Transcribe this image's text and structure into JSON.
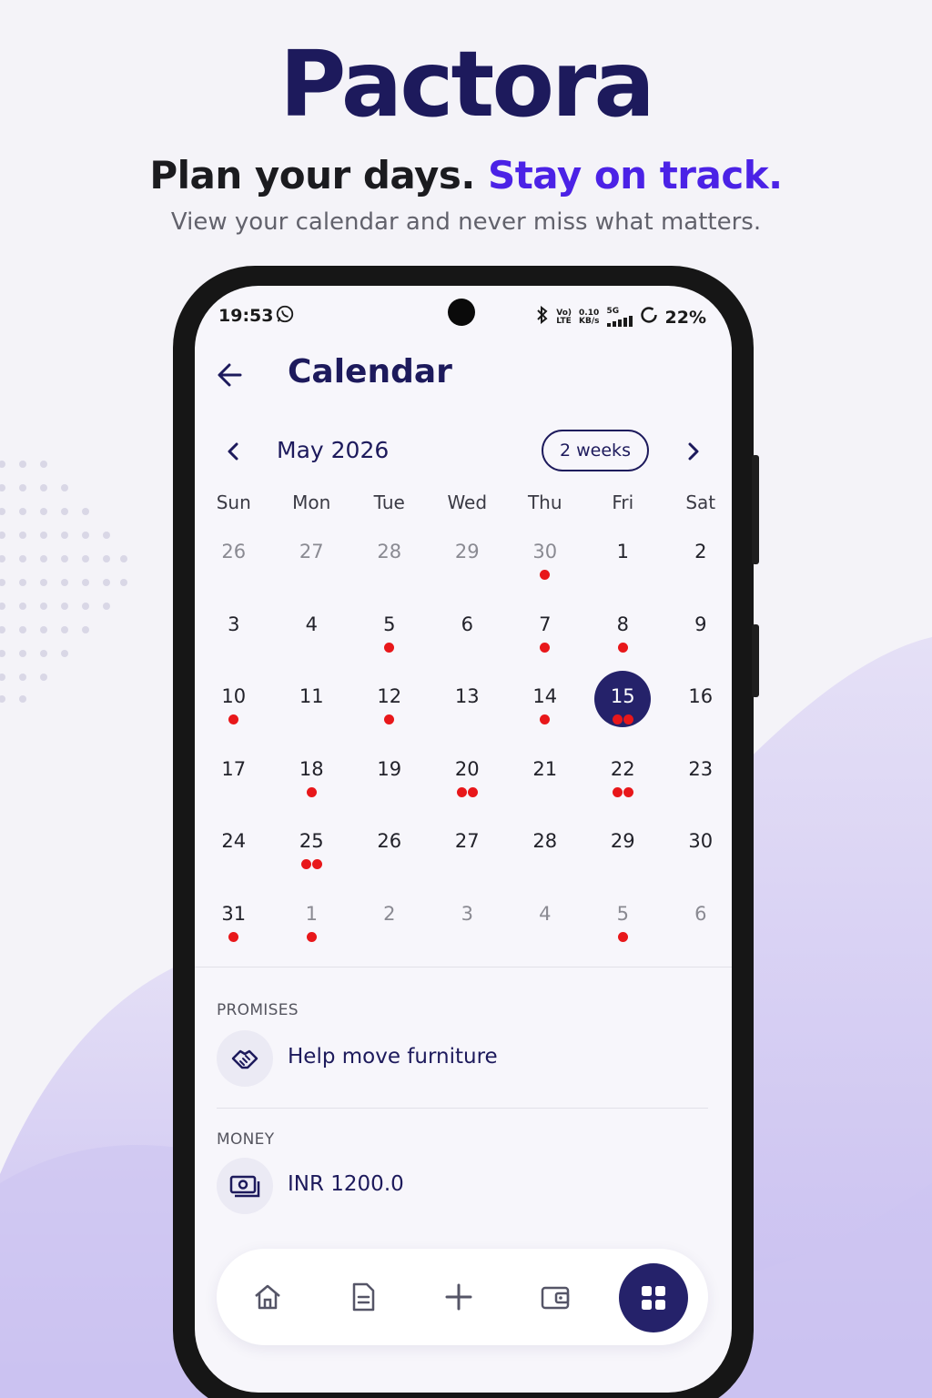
{
  "hero": {
    "brand": "Pactora",
    "tagline_main": "Plan your days.",
    "tagline_accent": "Stay on track.",
    "subtitle": "View your calendar and never miss what matters."
  },
  "status_bar": {
    "time": "19:53",
    "network_top": "Vo)",
    "network_bottom": "LTE",
    "speed_top": "0.10",
    "speed_bottom": "KB/s",
    "gen": "5G",
    "battery": "22%",
    "icons": [
      "whatsapp-icon",
      "bluetooth-icon",
      "signal-icon",
      "battery-icon"
    ]
  },
  "app_bar": {
    "title": "Calendar",
    "back_icon": "arrow-left-icon"
  },
  "calendar": {
    "month_label": "May 2026",
    "view_mode": "2 weeks",
    "weekdays": [
      "Sun",
      "Mon",
      "Tue",
      "Wed",
      "Thu",
      "Fri",
      "Sat"
    ],
    "weeks": [
      [
        {
          "d": "26",
          "m": true,
          "e": 0
        },
        {
          "d": "27",
          "m": true,
          "e": 0
        },
        {
          "d": "28",
          "m": true,
          "e": 0
        },
        {
          "d": "29",
          "m": true,
          "e": 0
        },
        {
          "d": "30",
          "m": true,
          "e": 1
        },
        {
          "d": "1",
          "m": false,
          "e": 0
        },
        {
          "d": "2",
          "m": false,
          "e": 0
        }
      ],
      [
        {
          "d": "3",
          "m": false,
          "e": 0
        },
        {
          "d": "4",
          "m": false,
          "e": 0
        },
        {
          "d": "5",
          "m": false,
          "e": 1
        },
        {
          "d": "6",
          "m": false,
          "e": 0
        },
        {
          "d": "7",
          "m": false,
          "e": 1
        },
        {
          "d": "8",
          "m": false,
          "e": 1
        },
        {
          "d": "9",
          "m": false,
          "e": 0
        }
      ],
      [
        {
          "d": "10",
          "m": false,
          "e": 1
        },
        {
          "d": "11",
          "m": false,
          "e": 0
        },
        {
          "d": "12",
          "m": false,
          "e": 1
        },
        {
          "d": "13",
          "m": false,
          "e": 0
        },
        {
          "d": "14",
          "m": false,
          "e": 1
        },
        {
          "d": "15",
          "m": false,
          "e": 2,
          "today": true
        },
        {
          "d": "16",
          "m": false,
          "e": 0
        }
      ],
      [
        {
          "d": "17",
          "m": false,
          "e": 0
        },
        {
          "d": "18",
          "m": false,
          "e": 1
        },
        {
          "d": "19",
          "m": false,
          "e": 0
        },
        {
          "d": "20",
          "m": false,
          "e": 2
        },
        {
          "d": "21",
          "m": false,
          "e": 0
        },
        {
          "d": "22",
          "m": false,
          "e": 2
        },
        {
          "d": "23",
          "m": false,
          "e": 0
        }
      ],
      [
        {
          "d": "24",
          "m": false,
          "e": 0
        },
        {
          "d": "25",
          "m": false,
          "e": 2
        },
        {
          "d": "26",
          "m": false,
          "e": 0
        },
        {
          "d": "27",
          "m": false,
          "e": 0
        },
        {
          "d": "28",
          "m": false,
          "e": 0
        },
        {
          "d": "29",
          "m": false,
          "e": 0
        },
        {
          "d": "30",
          "m": false,
          "e": 0
        }
      ],
      [
        {
          "d": "31",
          "m": false,
          "e": 1
        },
        {
          "d": "1",
          "m": true,
          "e": 1
        },
        {
          "d": "2",
          "m": true,
          "e": 0
        },
        {
          "d": "3",
          "m": true,
          "e": 0
        },
        {
          "d": "4",
          "m": true,
          "e": 0
        },
        {
          "d": "5",
          "m": true,
          "e": 1
        },
        {
          "d": "6",
          "m": true,
          "e": 0
        }
      ]
    ]
  },
  "agenda": {
    "promises_label": "PROMISES",
    "promise_item": "Help move furniture",
    "promise_icon": "handshake-icon",
    "money_label": "MONEY",
    "money_item": "INR 1200.0",
    "money_icon": "cash-icon"
  },
  "bottom_nav": {
    "items": [
      "home-icon",
      "document-icon",
      "add-icon",
      "wallet-icon",
      "grid-icon"
    ],
    "active": "grid-icon"
  },
  "colors": {
    "brand_navy": "#1d1a5c",
    "accent_purple": "#4b22e6",
    "event_dot": "#e8171a",
    "today_fill": "#25226a"
  }
}
